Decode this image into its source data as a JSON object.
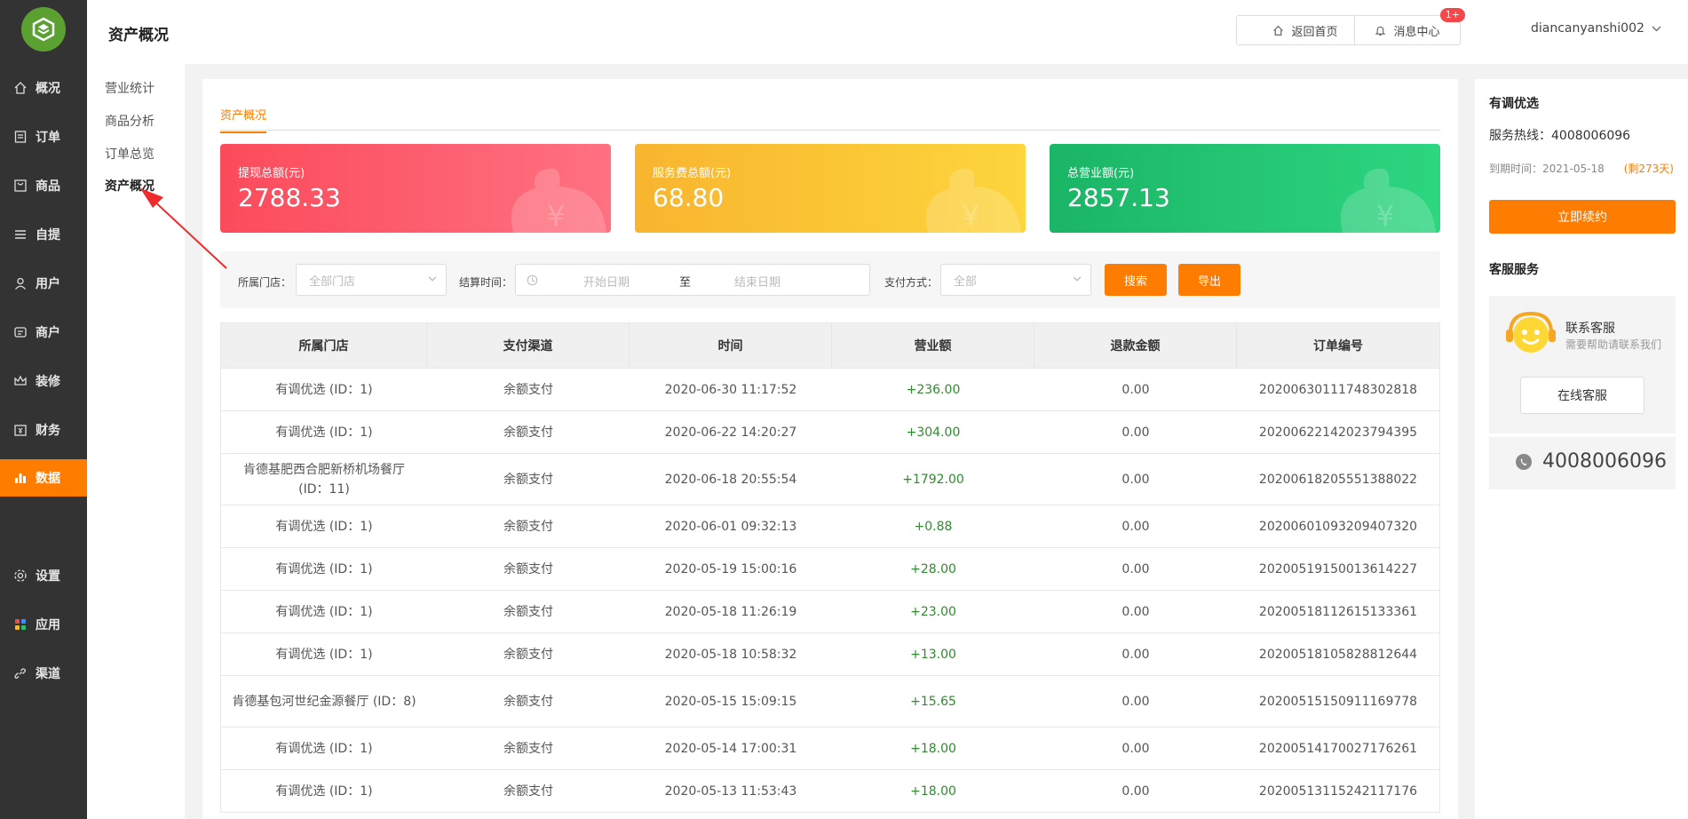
{
  "sidebar": {
    "items": [
      {
        "label": "概况",
        "icon": "home-icon"
      },
      {
        "label": "订单",
        "icon": "order-icon"
      },
      {
        "label": "商品",
        "icon": "goods-icon"
      },
      {
        "label": "自提",
        "icon": "list-icon"
      },
      {
        "label": "用户",
        "icon": "user-icon"
      },
      {
        "label": "商户",
        "icon": "merchant-icon"
      },
      {
        "label": "装修",
        "icon": "crown-icon"
      },
      {
        "label": "财务",
        "icon": "finance-icon"
      },
      {
        "label": "数据",
        "icon": "chart-icon",
        "active": true
      },
      {
        "label": "设置",
        "icon": "gear-icon"
      },
      {
        "label": "应用",
        "icon": "apps-icon"
      },
      {
        "label": "渠道",
        "icon": "link-icon"
      }
    ]
  },
  "submenu": {
    "items": [
      {
        "label": "营业统计"
      },
      {
        "label": "商品分析"
      },
      {
        "label": "订单总览"
      },
      {
        "label": "资产概况",
        "active": true
      }
    ]
  },
  "header": {
    "title": "资产概况",
    "home_label": "返回首页",
    "message_label": "消息中心",
    "message_badge": "1+",
    "username": "diancanyanshi002"
  },
  "main": {
    "tab_label": "资产概况",
    "cards": [
      {
        "label": "提现总额(元)",
        "value": "2788.33"
      },
      {
        "label": "服务费总额(元)",
        "value": "68.80"
      },
      {
        "label": "总营业额(元)",
        "value": "2857.13"
      }
    ],
    "filter": {
      "store_label": "所属门店：",
      "store_value": "全部门店",
      "time_label": "结算时间：",
      "start_placeholder": "开始日期",
      "to_label": "至",
      "end_placeholder": "结束日期",
      "pay_label": "支付方式：",
      "pay_value": "全部",
      "search_label": "搜索",
      "export_label": "导出"
    },
    "table": {
      "columns": [
        "所属门店",
        "支付渠道",
        "时间",
        "营业额",
        "退款金额",
        "订单编号"
      ],
      "rows": [
        {
          "store": "有调优选 (ID：1)",
          "channel": "余额支付",
          "time": "2020-06-30 11:17:52",
          "amount": "+236.00",
          "refund": "0.00",
          "order": "20200630111748302818"
        },
        {
          "store": "有调优选 (ID：1)",
          "channel": "余额支付",
          "time": "2020-06-22 14:20:27",
          "amount": "+304.00",
          "refund": "0.00",
          "order": "20200622142023794395"
        },
        {
          "store": "肯德基肥西合肥新桥机场餐厅 (ID：11)",
          "channel": "余额支付",
          "time": "2020-06-18 20:55:54",
          "amount": "+1792.00",
          "refund": "0.00",
          "order": "20200618205551388022"
        },
        {
          "store": "有调优选 (ID：1)",
          "channel": "余额支付",
          "time": "2020-06-01 09:32:13",
          "amount": "+0.88",
          "refund": "0.00",
          "order": "20200601093209407320"
        },
        {
          "store": "有调优选 (ID：1)",
          "channel": "余额支付",
          "time": "2020-05-19 15:00:16",
          "amount": "+28.00",
          "refund": "0.00",
          "order": "20200519150013614227"
        },
        {
          "store": "有调优选 (ID：1)",
          "channel": "余额支付",
          "time": "2020-05-18 11:26:19",
          "amount": "+23.00",
          "refund": "0.00",
          "order": "20200518112615133361"
        },
        {
          "store": "有调优选 (ID：1)",
          "channel": "余额支付",
          "time": "2020-05-18 10:58:32",
          "amount": "+13.00",
          "refund": "0.00",
          "order": "20200518105828812644"
        },
        {
          "store": "肯德基包河世纪金源餐厅 (ID：8)",
          "channel": "余额支付",
          "time": "2020-05-15 15:09:15",
          "amount": "+15.65",
          "refund": "0.00",
          "order": "20200515150911169778"
        },
        {
          "store": "有调优选 (ID：1)",
          "channel": "余额支付",
          "time": "2020-05-14 17:00:31",
          "amount": "+18.00",
          "refund": "0.00",
          "order": "20200514170027176261"
        },
        {
          "store": "有调优选 (ID：1)",
          "channel": "余额支付",
          "time": "2020-05-13 11:53:43",
          "amount": "+18.00",
          "refund": "0.00",
          "order": "20200513115242117176"
        }
      ]
    }
  },
  "right_panel": {
    "shop_name": "有调优选",
    "hotline": "服务热线：4008006096",
    "expire": "到期时间：2021-05-18",
    "remain": "(剩273天)",
    "renew_label": "立即续约",
    "service_title": "客服服务",
    "service_name": "联系客服",
    "service_sub": "需要帮助请联系我们",
    "online_label": "在线客服",
    "phone": "4008006096"
  },
  "colors": {
    "accent": "#fe7c00",
    "sidebar_bg": "#333333",
    "positive": "#2e8b2e",
    "card_red": "#fb4b5b",
    "card_yellow": "#f8b52f",
    "card_green": "#1ab566"
  }
}
